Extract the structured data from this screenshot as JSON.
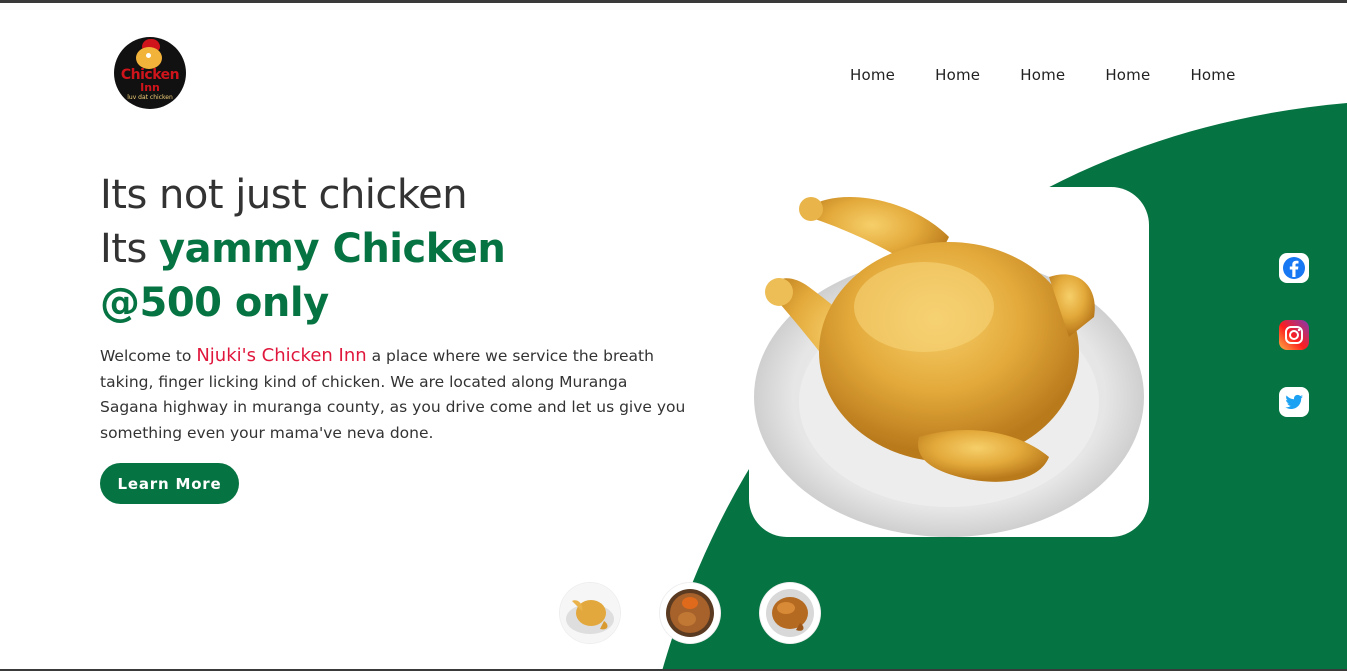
{
  "logo": {
    "line1": "Chicken",
    "line2": "Inn",
    "tagline": "luv dat chicken"
  },
  "nav": {
    "items": [
      "Home",
      "Home",
      "Home",
      "Home",
      "Home"
    ]
  },
  "hero": {
    "line1": "Its not just chicken",
    "line2_prefix": "Its ",
    "line2_accent": "yammy Chicken",
    "line3_accent": "@500 only",
    "desc_prefix": "Welcome to ",
    "brand_name": "Njuki's Chicken Inn",
    "desc_body": " a place where we service the breath taking, finger licking kind of chicken. We are located along Muranga Sagana highway in muranga county, as you drive come and let us give you something even your mama've neva done.",
    "cta_label": "Learn More"
  },
  "hero_image": {
    "icon": "roast-chicken-plate"
  },
  "social": [
    {
      "name": "facebook",
      "icon": "facebook-icon",
      "color": "#1877f2"
    },
    {
      "name": "instagram",
      "icon": "instagram-icon",
      "color": "#d6249f"
    },
    {
      "name": "twitter",
      "icon": "twitter-icon",
      "color": "#1da1f2"
    }
  ],
  "thumbnails": [
    {
      "icon": "roast-chicken-thumb"
    },
    {
      "icon": "chicken-sauce-thumb"
    },
    {
      "icon": "grilled-chicken-thumb"
    }
  ],
  "colors": {
    "brand_green": "#067342",
    "brand_red": "#e0173c",
    "text": "#333333"
  }
}
